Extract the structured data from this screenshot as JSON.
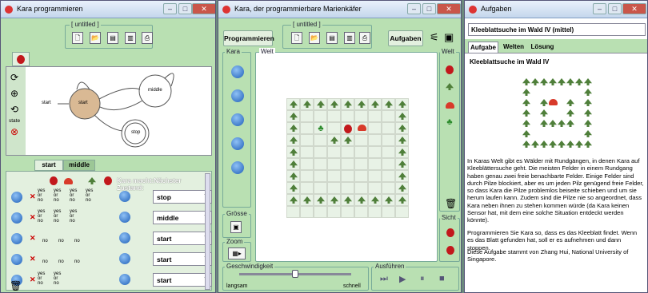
{
  "win1": {
    "title": "Kara programmieren",
    "toolbar_label": "[ untitled ]",
    "states": [
      "start",
      "middle",
      "stop"
    ],
    "state_tools": [
      "state"
    ],
    "tabs": [
      "start",
      "middle"
    ],
    "header_text": "Kara macht:Nächster Zustand:",
    "rows": [
      {
        "next": "stop"
      },
      {
        "next": "middle"
      },
      {
        "next": "start"
      },
      {
        "next": "start"
      },
      {
        "next": "start"
      }
    ],
    "yes": "yes",
    "or": "or",
    "no": "no"
  },
  "win2": {
    "title": "Kara, der programmierbare Marienkäfer",
    "prog_button": "Programmieren",
    "file_label": "[ untitled ]",
    "tasks_button": "Aufgaben",
    "kara_label": "Kara",
    "world_label": "Welt",
    "welt_right": "Welt",
    "size_label": "Grösse",
    "zoom_label": "Zoom",
    "speed_label": "Geschwindigkeit",
    "slow": "langsam",
    "fast": "schnell",
    "run_label": "Ausführen",
    "view_label": "Sicht"
  },
  "win3": {
    "title": "Aufgaben",
    "task_select": "Kleeblattsuche im Wald IV (mittel)",
    "tabs": [
      "Aufgabe",
      "Welten",
      "Lösung"
    ],
    "heading": "Kleeblattsuche im Wald IV",
    "para1": "In Karas Welt gibt es Wälder mit Rundgängen, in denen Kara auf Kleeblättersuche geht. Die meisten Felder in einem Rundgang haben genau zwei freie benachbarte Felder. Einige Felder sind durch Pilze blockiert, aber es um jeden Pilz genügend freie Felder, so dass Kara die Pilze problemlos beiseite schieben und um sie herum laufen kann. Zudem sind die Pilze nie so angeordnet, dass Kara neben ihnen zu stehen kommen würde (da Kara keinen Sensor hat, mit dem eine solche Situation entdeckt werden könnte).",
    "para2": "Programmieren Sie Kara so, dass es das Kleeblatt findet. Wenn es das Blatt gefunden hat, soll er es aufnehmen und dann stoppen.",
    "para3": "Diese Aufgabe stammt von Zhang Hui, National University of Singapore."
  }
}
